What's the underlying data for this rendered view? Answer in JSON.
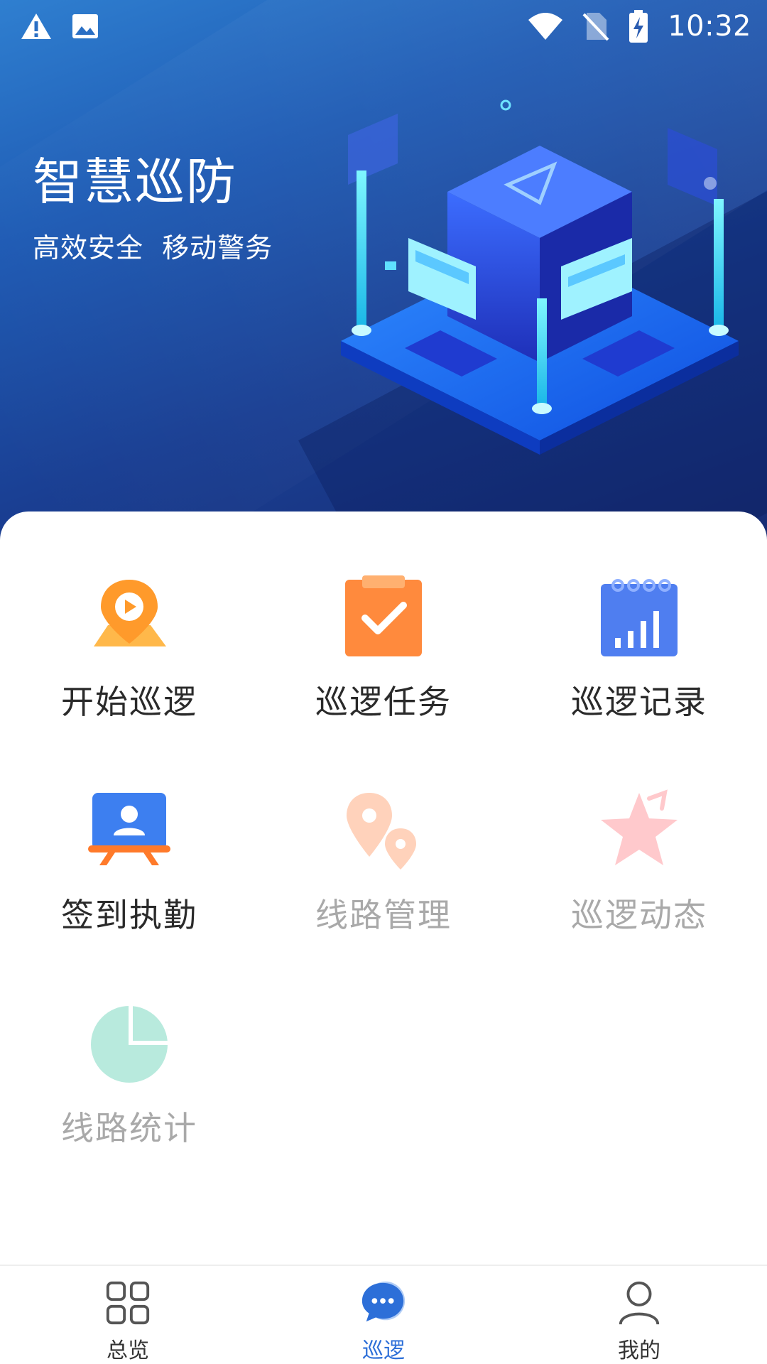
{
  "status_bar": {
    "time": "10:32"
  },
  "hero": {
    "title": "智慧巡防",
    "subtitle": "高效安全  移动警务"
  },
  "colors": {
    "hero_gradient": [
      "#2f7fd0",
      "#172c73"
    ],
    "active_nav": "#2d6fd8",
    "disabled_text": "#a9a9a9"
  },
  "menu": [
    {
      "label": "开始巡逻",
      "icon": "map-pin-play-icon",
      "enabled": true
    },
    {
      "label": "巡逻任务",
      "icon": "clipboard-check-icon",
      "enabled": true
    },
    {
      "label": "巡逻记录",
      "icon": "notebook-chart-icon",
      "enabled": true
    },
    {
      "label": "签到执勤",
      "icon": "person-board-icon",
      "enabled": true
    },
    {
      "label": "线路管理",
      "icon": "route-pins-icon",
      "enabled": false
    },
    {
      "label": "巡逻动态",
      "icon": "star-icon",
      "enabled": false
    },
    {
      "label": "线路统计",
      "icon": "pie-chart-icon",
      "enabled": false
    }
  ],
  "bottom_nav": [
    {
      "label": "总览",
      "icon": "grid-icon",
      "active": false
    },
    {
      "label": "巡逻",
      "icon": "chat-bubble-icon",
      "active": true
    },
    {
      "label": "我的",
      "icon": "person-icon",
      "active": false
    }
  ]
}
